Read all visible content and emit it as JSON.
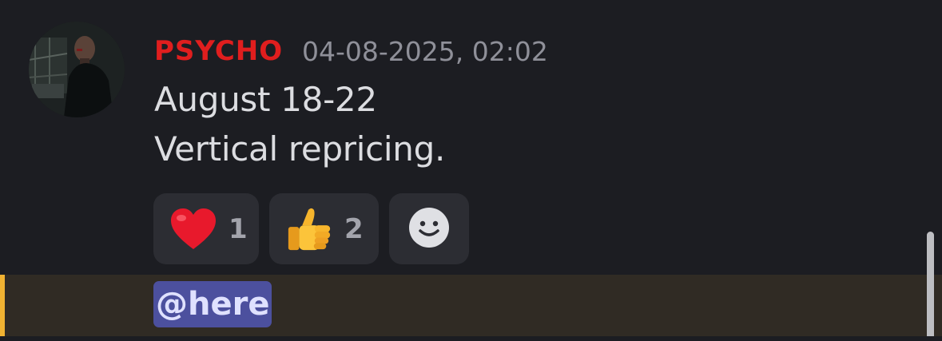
{
  "message": {
    "author": "PSYCHO",
    "timestamp": "04-08-2025, 02:02",
    "lines": [
      "August 18-22",
      "Vertical repricing."
    ],
    "author_color": "#e01e1e"
  },
  "reactions": [
    {
      "emoji": "heart",
      "count": "1"
    },
    {
      "emoji": "thumbs-up",
      "count": "2"
    }
  ],
  "add_reaction": {
    "icon": "smiley-add-reaction-icon"
  },
  "next_message": {
    "mention": "@here",
    "highlight_color": "#f0b232"
  }
}
